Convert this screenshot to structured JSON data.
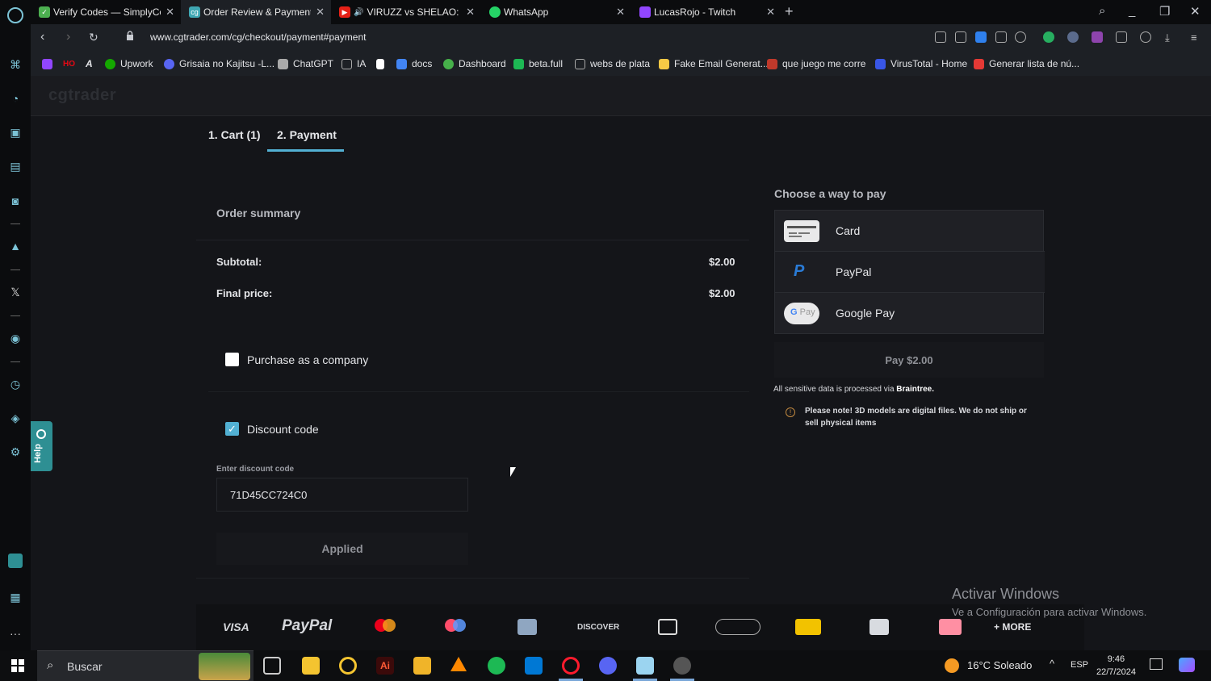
{
  "browser": {
    "tabs": [
      {
        "title": "Verify Codes — SimplyCod",
        "favicon": "simplycodes-icon",
        "color": "#4caf50"
      },
      {
        "title": "Order Review & Payment -",
        "favicon": "cgtrader-icon",
        "color": "#3fa7b3"
      },
      {
        "title": "VIRUZZ vs SHELAO: MI",
        "favicon": "youtube-icon",
        "color": "#e62117"
      },
      {
        "title": "WhatsApp",
        "favicon": "whatsapp-icon",
        "color": "#25d366"
      },
      {
        "title": "LucasRojo - Twitch",
        "favicon": "twitch-icon",
        "color": "#9146ff"
      }
    ],
    "url": "www.cgtrader.com/cg/checkout/payment#payment",
    "bookmarks": [
      {
        "label": "",
        "color": "#9146ff"
      },
      {
        "label": "HO",
        "color": "#e50914"
      },
      {
        "label": "A",
        "color": "#ffffff"
      },
      {
        "label": "Upwork",
        "color": "#14a800"
      },
      {
        "label": "Grisaia no Kajitsu -L...",
        "color": "#5865f2"
      },
      {
        "label": "ChatGPT",
        "color": "#aaaaaa"
      },
      {
        "label": "IA",
        "color": "#888888"
      },
      {
        "label": "",
        "color": "#ffffff"
      },
      {
        "label": "docs",
        "color": "#4285f4"
      },
      {
        "label": "Dashboard",
        "color": "#46b04a"
      },
      {
        "label": "beta.full",
        "color": "#1db954"
      },
      {
        "label": "webs de plata",
        "color": "#888888"
      },
      {
        "label": "Fake Email Generat...",
        "color": "#f6c945"
      },
      {
        "label": "que juego me corre",
        "color": "#c0392b"
      },
      {
        "label": "VirusTotal - Home",
        "color": "#3956e6"
      },
      {
        "label": "Generar lista de nú...",
        "color": "#e53935"
      }
    ]
  },
  "site": {
    "logo": "cgtrader",
    "steps": [
      "1. Cart (1)",
      "2. Payment"
    ],
    "order_summary": {
      "title": "Order summary",
      "subtotal_label": "Subtotal:",
      "subtotal_value": "$2.00",
      "final_label": "Final price:",
      "final_value": "$2.00"
    },
    "purchase_company": {
      "label": "Purchase as a company",
      "checked": false
    },
    "discount": {
      "label": "Discount code",
      "checked": true,
      "field_label": "Enter discount code",
      "value": "71D45CC724C0",
      "button": "Applied"
    },
    "pay": {
      "title": "Choose a way to pay",
      "methods": [
        {
          "name": "Card",
          "icon": "card-icon"
        },
        {
          "name": "PayPal",
          "icon": "paypal-icon"
        },
        {
          "name": "Google Pay",
          "icon": "google-pay-icon"
        }
      ],
      "button": "Pay $2.00",
      "braintree_prefix": "All sensitive data is processed via ",
      "braintree_name": "Braintree.",
      "note": "Please note! 3D models are digital files. We do not ship or sell physical items"
    },
    "help": "Help",
    "logos": {
      "visa": "VISA",
      "paypal": "PayPal",
      "discover": "DISCOVER",
      "more": "+ MORE"
    }
  },
  "windows_watermark": {
    "line1": "Activar Windows",
    "line2": "Ve a Configuración para activar Windows."
  },
  "taskbar": {
    "search": "Buscar",
    "weather": "16°C  Soleado",
    "lang": "ESP",
    "time": "9:46",
    "date": "22/7/2024"
  }
}
